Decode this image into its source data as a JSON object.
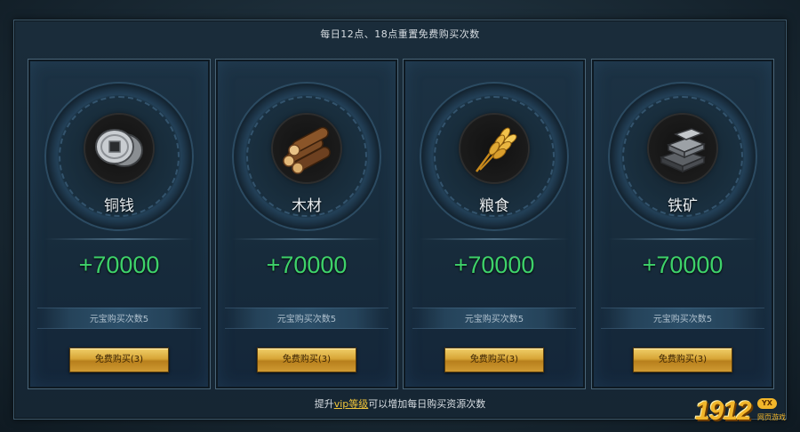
{
  "header": {
    "reset_note": "每日12点、18点重置免费购买次数"
  },
  "cards": [
    {
      "icon": "copper-coin-icon",
      "name": "铜钱",
      "amount": "+70000",
      "count_text": "元宝购买次数5",
      "button_label": "免费购买(3)"
    },
    {
      "icon": "wood-logs-icon",
      "name": "木材",
      "amount": "+70000",
      "count_text": "元宝购买次数5",
      "button_label": "免费购买(3)"
    },
    {
      "icon": "grain-wheat-icon",
      "name": "粮食",
      "amount": "+70000",
      "count_text": "元宝购买次数5",
      "button_label": "免费购买(3)"
    },
    {
      "icon": "iron-ingot-icon",
      "name": "铁矿",
      "amount": "+70000",
      "count_text": "元宝购买次数5",
      "button_label": "免费购买(3)"
    }
  ],
  "footer": {
    "prefix": "提升",
    "vip_link": "vip等级",
    "suffix": "可以增加每日购买资源次数"
  },
  "logo": {
    "number": "1912",
    "badge": "YX",
    "sub": "网页游戏"
  },
  "colors": {
    "amount_green": "#3ed26a",
    "button_gold": "#d7a536",
    "vip_gold": "#f2c63a"
  }
}
